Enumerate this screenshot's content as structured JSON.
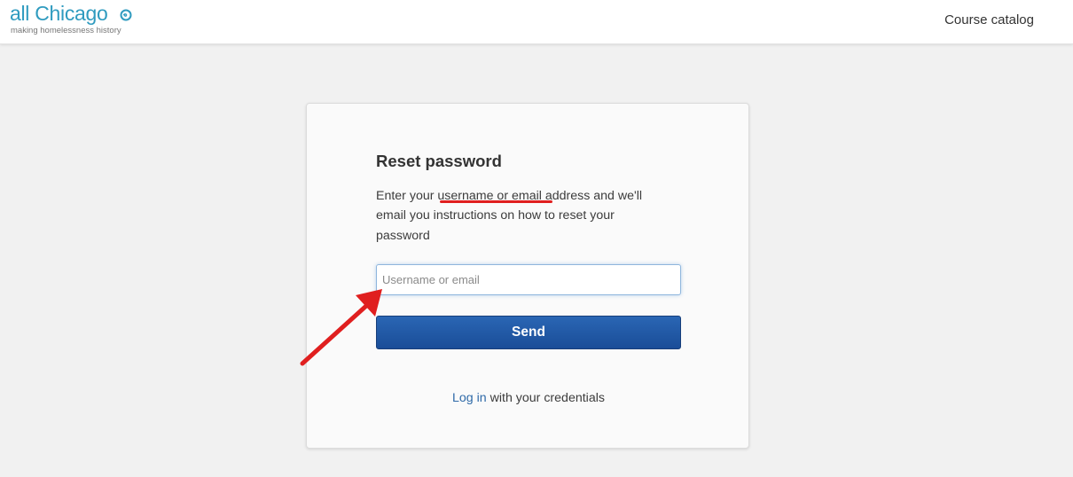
{
  "header": {
    "logo": {
      "name": "all Chicago",
      "tagline": "making homelessness history"
    },
    "nav": {
      "course_catalog": "Course catalog"
    }
  },
  "reset_form": {
    "title": "Reset password",
    "description": {
      "before": "Enter your ",
      "highlight": "username or email",
      "after": " address and we'll email you instructions on how to reset your password"
    },
    "input": {
      "placeholder": "Username or email",
      "value": ""
    },
    "send_button": "Send",
    "login": {
      "link_text": "Log in",
      "rest": " with your credentials"
    }
  },
  "annotations": {
    "mark_color": "#e01f1f",
    "icons": [
      "red-arrow-icon",
      "red-underline-mark",
      "logo-swirl-icon"
    ]
  },
  "colors": {
    "background": "#f1f1f1",
    "card": "#fafafa",
    "brand": "#2f9bbf",
    "button": "#1f55a3",
    "link": "#2f6aa8"
  }
}
